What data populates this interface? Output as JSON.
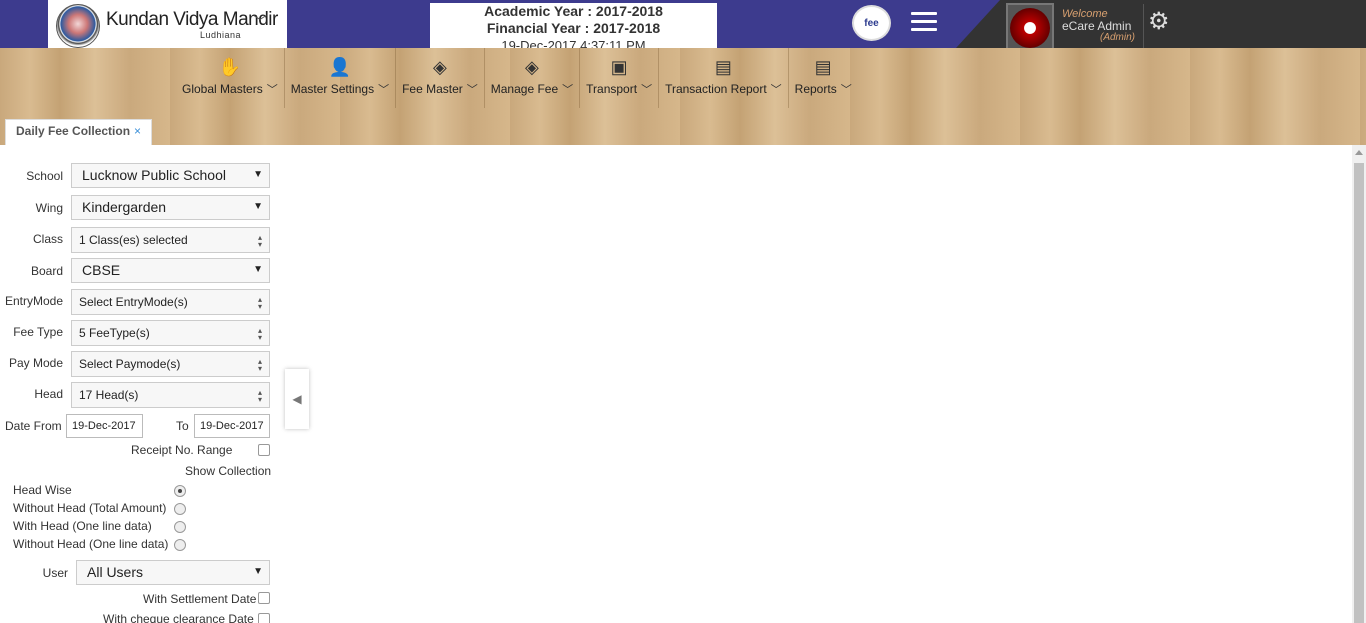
{
  "header": {
    "org_name": "Kundan Vidya Mandir",
    "org_city": "Ludhiana",
    "academic_year": "Academic Year : 2017-2018",
    "financial_year": "Financial Year : 2017-2018",
    "datetime": "19-Dec-2017 4:37:11 PM",
    "product_logo": "fee",
    "welcome": "Welcome",
    "user_name": "eCare Admin",
    "user_role": "(Admin)"
  },
  "menu": [
    {
      "label": "Global Masters",
      "icon": "handshake-icon"
    },
    {
      "label": "Master Settings",
      "icon": "user-edit-icon"
    },
    {
      "label": "Fee Master",
      "icon": "money-icon"
    },
    {
      "label": "Manage Fee",
      "icon": "money-icon"
    },
    {
      "label": "Transport",
      "icon": "bus-icon"
    },
    {
      "label": "Transaction Report",
      "icon": "document-icon"
    },
    {
      "label": "Reports",
      "icon": "document-icon"
    }
  ],
  "tab": {
    "label": "Daily Fee Collection",
    "close": "×"
  },
  "form": {
    "school": {
      "label": "School",
      "value": "Lucknow Public School"
    },
    "wing": {
      "label": "Wing",
      "value": "Kindergarden"
    },
    "class": {
      "label": "Class",
      "value": "1 Class(es) selected"
    },
    "board": {
      "label": "Board",
      "value": "CBSE"
    },
    "entry_mode": {
      "label": "EntryMode",
      "value": "Select EntryMode(s)"
    },
    "fee_type": {
      "label": "Fee Type",
      "value": "5 FeeType(s)"
    },
    "pay_mode": {
      "label": "Pay Mode",
      "value": "Select Paymode(s)"
    },
    "head": {
      "label": "Head",
      "value": "17 Head(s)"
    },
    "date_from": {
      "label": "Date From",
      "value": "19-Dec-2017"
    },
    "date_to": {
      "label": "To",
      "value": "19-Dec-2017"
    },
    "receipt_range": {
      "label": "Receipt No. Range"
    },
    "show_collection": {
      "label": "Show Collection"
    },
    "collection_options": [
      {
        "label": "Head Wise",
        "selected": true
      },
      {
        "label": "Without Head (Total Amount)",
        "selected": false
      },
      {
        "label": "With Head (One line data)",
        "selected": false
      },
      {
        "label": "Without Head (One line data)",
        "selected": false
      }
    ],
    "user": {
      "label": "User",
      "value": "All Users"
    },
    "settlement_date": {
      "label": "With Settlement Date"
    },
    "cheque_date": {
      "label": "With cheque clearance Date"
    }
  },
  "colors": {
    "header_bg": "#3d3b8e",
    "accent": "#3a8fd8"
  }
}
